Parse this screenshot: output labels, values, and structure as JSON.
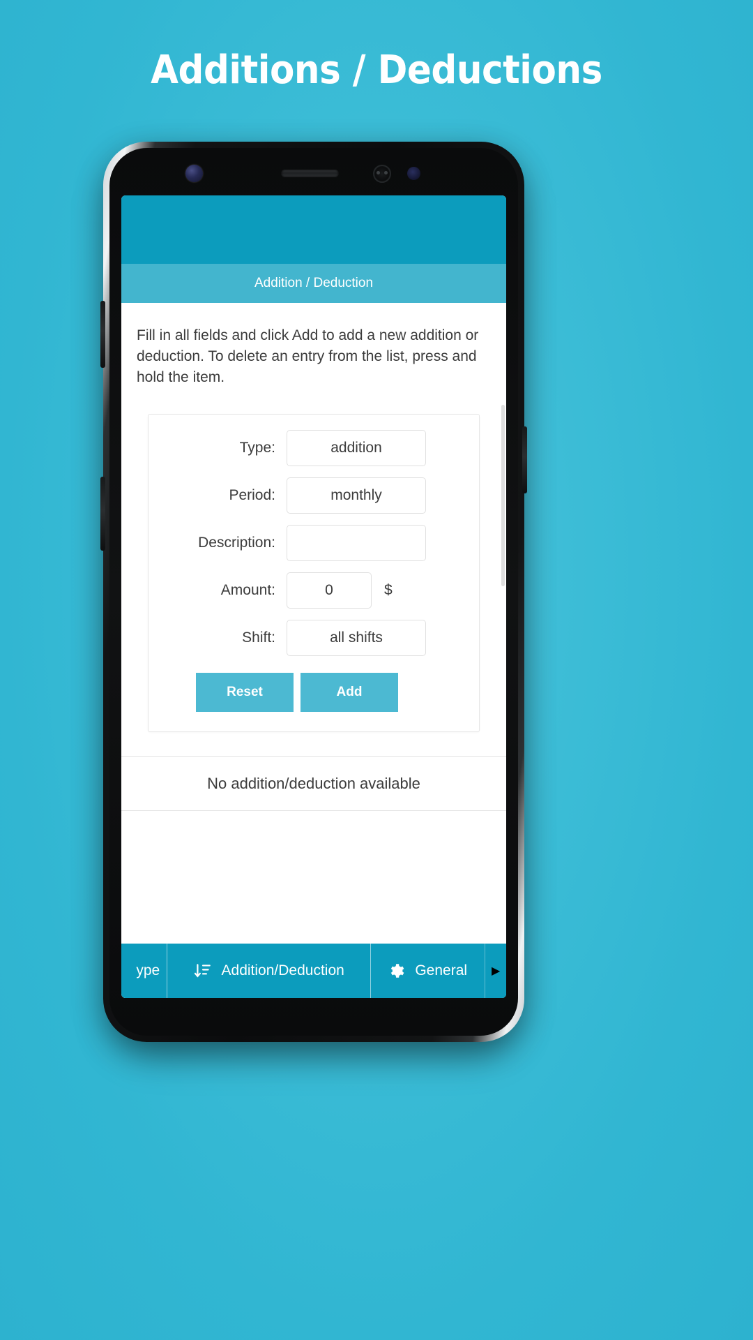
{
  "page": {
    "title": "Additions / Deductions",
    "background_color": "#3bbcd6"
  },
  "app": {
    "subheader_title": "Addition / Deduction",
    "instructions": "Fill in all fields and click Add to add a new addition or deduction. To delete an entry from the list, press and hold the item.",
    "accent_color": "#0c9cbd",
    "subheader_color": "#43b5ce",
    "button_color": "#4cb9d2",
    "form": {
      "fields": [
        {
          "label": "Type:",
          "value": "addition",
          "unit": ""
        },
        {
          "label": "Period:",
          "value": "monthly",
          "unit": ""
        },
        {
          "label": "Description:",
          "value": "",
          "unit": ""
        },
        {
          "label": "Amount:",
          "value": "0",
          "unit": "$"
        },
        {
          "label": "Shift:",
          "value": "all shifts",
          "unit": ""
        }
      ],
      "reset_label": "Reset",
      "add_label": "Add"
    },
    "list": {
      "empty_message": "No addition/deduction available"
    },
    "tabs": [
      {
        "label": "ype",
        "icon": "",
        "partial": true
      },
      {
        "label": "Addition/Deduction",
        "icon": "sort-descending-icon",
        "partial": false
      },
      {
        "label": "General",
        "icon": "gear-icon",
        "partial": false
      }
    ],
    "tab_scroll_arrow": "▶"
  }
}
